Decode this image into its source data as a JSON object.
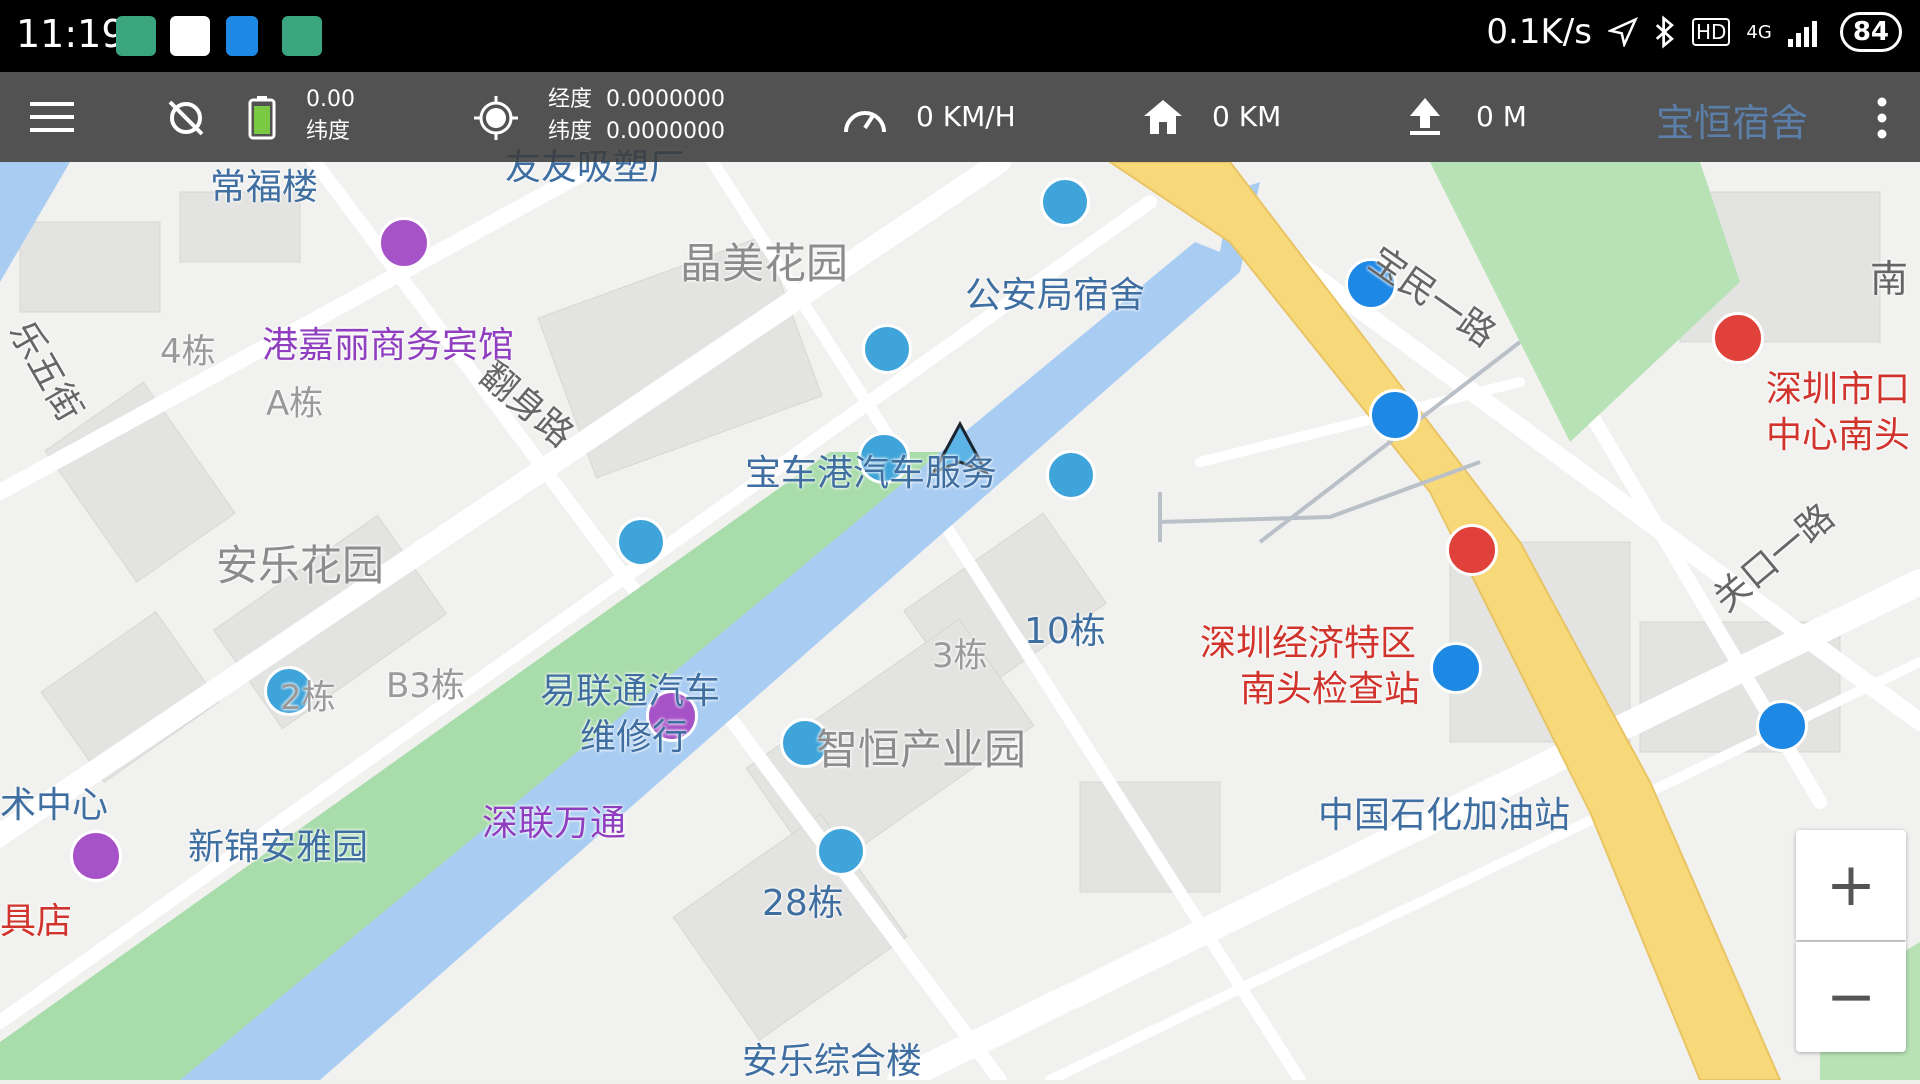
{
  "status_bar": {
    "time": "11:19",
    "net_speed": "0.1K/s",
    "hd": "HD",
    "network": "4G",
    "battery": "84",
    "icons": [
      "android-icon",
      "mi-icon",
      "notes-icon",
      "android-icon",
      "location-arrow-icon",
      "bluetooth-icon",
      "signal-icon"
    ]
  },
  "toolbar": {
    "battery_value": "0.00",
    "lat_label_1": "纬度",
    "lng_label": "经度",
    "lng_value": "0.0000000",
    "lat_label_2": "纬度",
    "lat_value": "0.0000000",
    "speed": "0 KM/H",
    "home_distance": "0 KM",
    "altitude": "0 M",
    "icons": [
      "menu-icon",
      "gps-off-icon",
      "battery-icon",
      "gps-fix-icon",
      "speedometer-icon",
      "home-icon",
      "altitude-icon",
      "more-icon"
    ]
  },
  "map": {
    "labels": {
      "changfu": "常福楼",
      "youyou": "友友吸塑厂",
      "baoheng": "宝恒宿舍",
      "jingmei": "晶美花园",
      "gongan": "公安局宿舍",
      "baomin": "宝民一路",
      "nan": "南",
      "gangjiali": "港嘉丽商务宾馆",
      "b4": "4栋",
      "bA": "A栋",
      "lewu": "乐五街",
      "fanshen": "翻身路",
      "baoche": "宝车港汽车服务",
      "szk1": "深圳市口",
      "szk2": "中心南头",
      "guankou": "关口一路",
      "anle": "安乐花园",
      "b10": "10栋",
      "b3": "3栋",
      "tequ1": "深圳经济特区",
      "tequ2": "南头检查站",
      "b2": "2栋",
      "bB3": "B3栋",
      "yilian1": "易联通汽车",
      "yilian2": "维修行",
      "zhiheng": "智恒产业园",
      "shuzx": "术中心",
      "sinopec": "中国石化加油站",
      "xinjin": "新锦安雅园",
      "shenlian": "深联万通",
      "b28": "28栋",
      "judian": "具店",
      "anle_zh": "安乐综合楼"
    },
    "zoom_in": "+",
    "zoom_out": "−",
    "colors": {
      "water": "#a9cdf2",
      "park": "#a8dcaa",
      "highway": "#f8d97a",
      "poi_blue": "#3fa4d9",
      "poi_purple": "#a653c7",
      "poi_red": "#e0413a"
    }
  }
}
